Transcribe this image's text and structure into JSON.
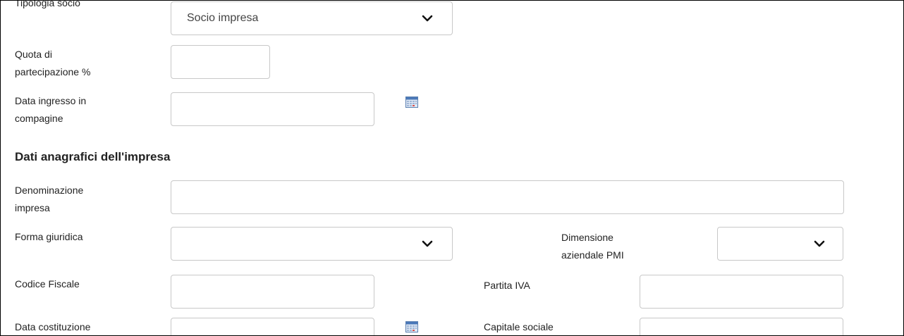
{
  "form": {
    "tipologia_socio": {
      "label": "Tipologia socio",
      "value": "Socio impresa"
    },
    "quota": {
      "label_line1": "Quota di",
      "label_line2": "partecipazione %",
      "value": ""
    },
    "data_ingresso": {
      "label_line1": "Data ingresso in",
      "label_line2": "compagine",
      "value": ""
    }
  },
  "section": {
    "title": "Dati anagrafici dell'impresa"
  },
  "impresa": {
    "denominazione": {
      "label_line1": "Denominazione",
      "label_line2": "impresa",
      "value": ""
    },
    "forma_giuridica": {
      "label": "Forma giuridica",
      "value": ""
    },
    "dimensione": {
      "label_line1": "Dimensione",
      "label_line2": "aziendale PMI",
      "value": ""
    },
    "codice_fiscale": {
      "label": "Codice Fiscale",
      "value": ""
    },
    "partita_iva": {
      "label": "Partita IVA",
      "value": ""
    },
    "data_costituzione": {
      "label": "Data costituzione",
      "value": ""
    },
    "capitale_sociale": {
      "label": "Capitale sociale",
      "value": ""
    }
  },
  "icons": {
    "calendar": "calendar-icon",
    "chevron": "chevron-down-icon"
  }
}
